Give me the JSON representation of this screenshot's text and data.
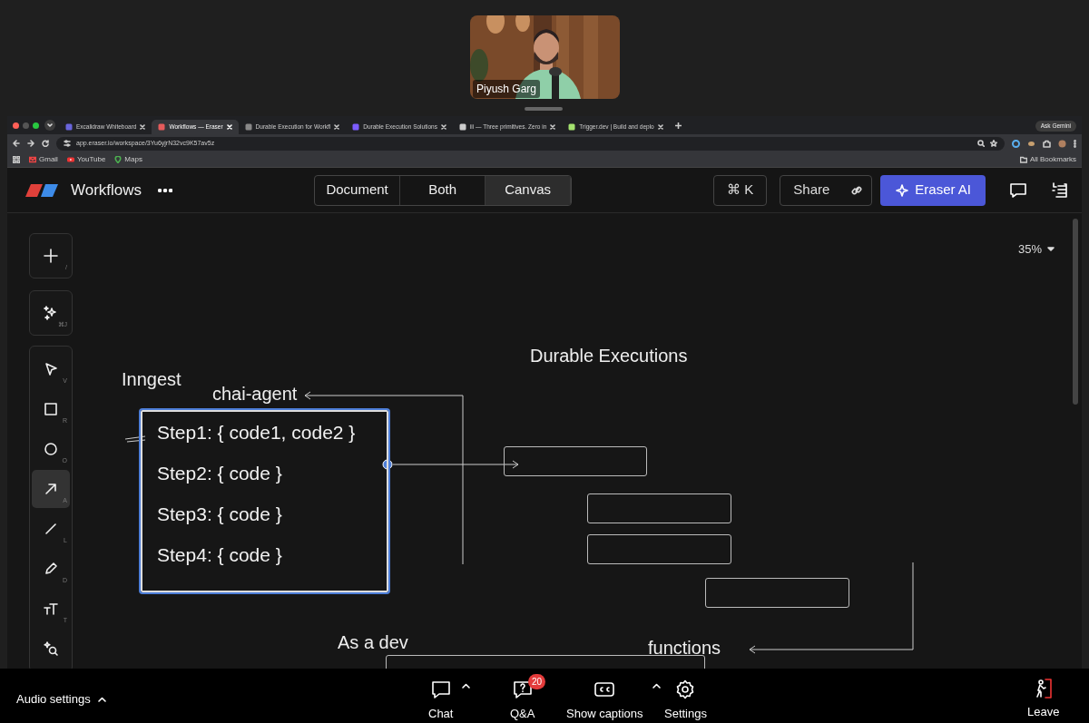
{
  "meeting": {
    "speaker": {
      "name": "Piyush Garg"
    }
  },
  "browser": {
    "tabs": [
      {
        "title": "Excalidraw Whiteboard",
        "selected": false
      },
      {
        "title": "Workflows — Eraser",
        "selected": true
      },
      {
        "title": "Durable Execution for Workfl",
        "selected": false
      },
      {
        "title": "Durable Execution Solutions",
        "selected": false
      },
      {
        "title": "iii — Three primitives. Zero in",
        "selected": false
      },
      {
        "title": "Trigger.dev | Build and deplo",
        "selected": false
      }
    ],
    "ask_gemini": "Ask Gemini",
    "url": "app.eraser.io/workspace/3Yu6yjrN32vc9K57av5z",
    "bookmarks": [
      {
        "label": "Gmail",
        "kind": "mail"
      },
      {
        "label": "YouTube",
        "kind": "video"
      },
      {
        "label": "Maps",
        "kind": "map"
      }
    ],
    "all_bookmarks": "All Bookmarks"
  },
  "app": {
    "title": "Workflows",
    "view_modes": [
      {
        "label": "Document",
        "selected": false
      },
      {
        "label": "Both",
        "selected": false
      },
      {
        "label": "Canvas",
        "selected": true
      }
    ],
    "command_shortcut": "⌘ K",
    "share": "Share",
    "ai_button": "Eraser AI",
    "zoom": "35%"
  },
  "tool_groups": [
    {
      "tools": [
        {
          "kind": "add",
          "shortcut": "/",
          "selected": false
        }
      ]
    },
    {
      "tools": [
        {
          "kind": "sparkle",
          "shortcut": "⌘J",
          "selected": false
        }
      ]
    },
    {
      "tools": [
        {
          "kind": "select",
          "shortcut": "V",
          "selected": false
        },
        {
          "kind": "rectangle",
          "shortcut": "R",
          "selected": false
        },
        {
          "kind": "ellipse",
          "shortcut": "O",
          "selected": false
        },
        {
          "kind": "arrow",
          "shortcut": "A",
          "selected": true
        },
        {
          "kind": "line",
          "shortcut": "L",
          "selected": false
        },
        {
          "kind": "pencil",
          "shortcut": "D",
          "selected": false
        },
        {
          "kind": "text",
          "shortcut": "T",
          "selected": false
        },
        {
          "kind": "search",
          "selected": false
        }
      ]
    }
  ],
  "canvas": {
    "labels": [
      {
        "text": "Durable Executions"
      },
      {
        "text": "Inngest"
      },
      {
        "text": "chai-agent"
      },
      {
        "text": "As a dev"
      },
      {
        "text": "functions"
      }
    ],
    "step_box": {
      "lines": [
        {
          "text": "Step1: { code1, code2 }"
        },
        {
          "text": "Step2: { code }"
        },
        {
          "text": "Step3: { code }"
        },
        {
          "text": "Step4: { code }"
        }
      ]
    }
  },
  "bottom_bar": {
    "audio_settings": "Audio settings",
    "buttons": [
      {
        "kind": "chat",
        "label": "Chat",
        "caret": true
      },
      {
        "kind": "qa",
        "label": "Q&A",
        "badge": "20",
        "caret": false
      },
      {
        "kind": "captions",
        "label": "Show captions",
        "caret": true
      },
      {
        "kind": "settings",
        "label": "Settings",
        "caret": false
      }
    ],
    "leave": "Leave"
  }
}
